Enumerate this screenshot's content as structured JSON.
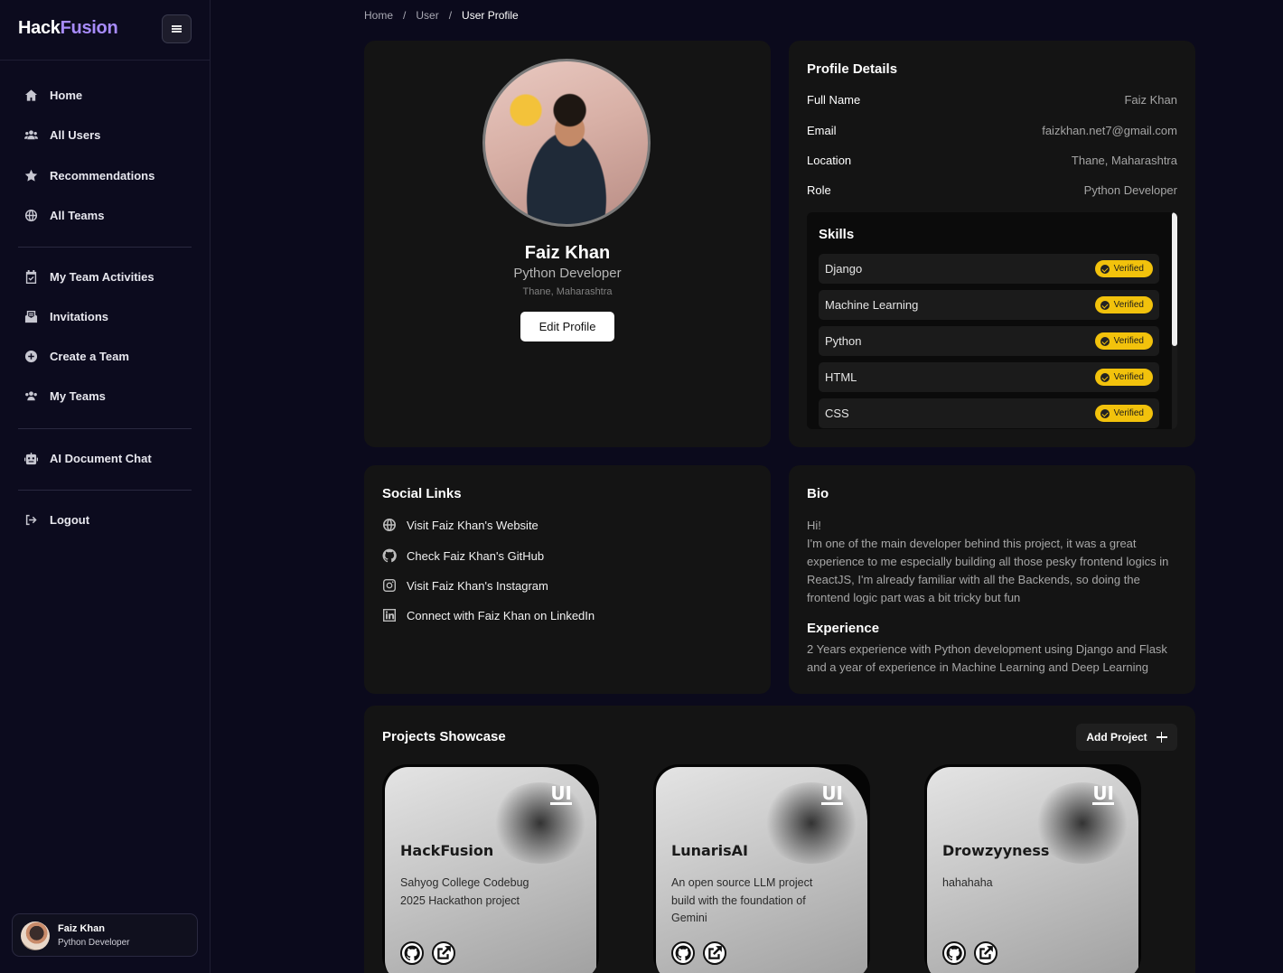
{
  "app": {
    "logo_a": "Hack",
    "logo_b": "Fusion"
  },
  "sidebar": {
    "items": [
      {
        "label": "Home"
      },
      {
        "label": "All Users"
      },
      {
        "label": "Recommendations"
      },
      {
        "label": "All Teams"
      },
      {
        "label": "My Team Activities"
      },
      {
        "label": "Invitations"
      },
      {
        "label": "Create a Team"
      },
      {
        "label": "My Teams"
      },
      {
        "label": "AI Document Chat"
      },
      {
        "label": "Logout"
      }
    ],
    "user": {
      "name": "Faiz Khan",
      "role": "Python Developer"
    }
  },
  "breadcrumb": {
    "home": "Home",
    "sep": "/",
    "user": "User",
    "current": "User Profile"
  },
  "profile": {
    "name": "Faiz Khan",
    "role": "Python Developer",
    "location": "Thane, Maharashtra",
    "edit_label": "Edit Profile"
  },
  "details": {
    "title": "Profile Details",
    "rows": [
      {
        "label": "Full Name",
        "value": "Faiz Khan"
      },
      {
        "label": "Email",
        "value": "faizkhan.net7@gmail.com"
      },
      {
        "label": "Location",
        "value": "Thane, Maharashtra"
      },
      {
        "label": "Role",
        "value": "Python Developer"
      }
    ],
    "skills_title": "Skills",
    "skills": [
      {
        "name": "Django",
        "badge": "Verified"
      },
      {
        "name": "Machine Learning",
        "badge": "Verified"
      },
      {
        "name": "Python",
        "badge": "Verified"
      },
      {
        "name": "HTML",
        "badge": "Verified"
      },
      {
        "name": "CSS",
        "badge": "Verified"
      }
    ]
  },
  "social": {
    "title": "Social Links",
    "links": [
      {
        "label": "Visit Faiz Khan's Website",
        "icon": "globe-icon"
      },
      {
        "label": "Check Faiz Khan's GitHub",
        "icon": "github-icon"
      },
      {
        "label": "Visit Faiz Khan's Instagram",
        "icon": "instagram-icon"
      },
      {
        "label": "Connect with Faiz Khan on LinkedIn",
        "icon": "linkedin-icon"
      }
    ]
  },
  "bio": {
    "title": "Bio",
    "text": "Hi!\nI'm one of the main developer behind this project, it was a great experience to me especially building all those pesky frontend logics in ReactJS, I'm already familiar with all the Backends, so doing the frontend logic part was a bit tricky but fun",
    "exp_title": "Experience",
    "exp_text": "2 Years experience with Python development using Django and Flask and a year of experience in Machine Learning and Deep Learning"
  },
  "projects": {
    "title": "Projects Showcase",
    "add_label": "Add Project",
    "items": [
      {
        "badge": "UI",
        "title": "HackFusion",
        "desc": "Sahyog College Codebug 2025 Hackathon project"
      },
      {
        "badge": "UI",
        "title": "LunarisAI",
        "desc": "An open source LLM project build with the foundation of Gemini"
      },
      {
        "badge": "UI",
        "title": "Drowzyyness",
        "desc": "hahahaha"
      }
    ]
  },
  "colors": {
    "accent": "#a78bfa",
    "badge": "#f2c20c",
    "card": "#141414",
    "background": "#0b0a1c"
  }
}
